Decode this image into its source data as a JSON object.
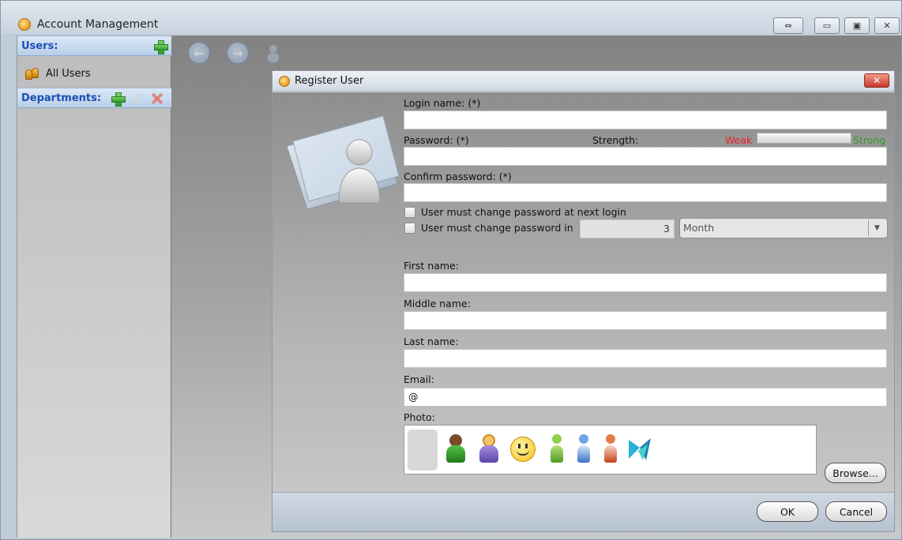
{
  "window": {
    "title": "Account Management",
    "buttons": {
      "restore_label": "⇔",
      "minimize_label": "▭",
      "maximize_label": "▣",
      "close_label": "✕"
    }
  },
  "sidebar": {
    "users_header": "Users:",
    "all_users_label": "All Users",
    "departments_header": "Departments:"
  },
  "toolbar": {
    "back_label": "←",
    "forward_label": "→"
  },
  "dialog": {
    "title": "Register User",
    "close_label": "✕",
    "login_label": "Login name: (*)",
    "login_value": "",
    "password_label": "Password: (*)",
    "strength_label": "Strength:",
    "weak_label": "Weak",
    "strong_label": "Strong",
    "password_value": "",
    "confirm_label": "Confirm password: (*)",
    "confirm_value": "",
    "must_change_next_label": "User must change password at next login",
    "must_change_in_label": "User must change password in",
    "period_number": "3",
    "period_unit": "Month",
    "first_name_label": "First name:",
    "middle_name_label": "Middle name:",
    "last_name_label": "Last name:",
    "email_label": "Email:",
    "email_value": "@",
    "photo_label": "Photo:",
    "browse_label": "Browse...",
    "ok_label": "OK",
    "cancel_label": "Cancel"
  },
  "colors": {
    "weak": "#e8232a",
    "strong": "#3a9a2a",
    "header_text": "#1a4fb5"
  },
  "photo_icons": [
    "blank-photo",
    "man-green-icon",
    "woman-purple-icon",
    "smiley-icon",
    "person-green-icon",
    "person-blue-icon",
    "person-red-icon",
    "logo-icon"
  ]
}
